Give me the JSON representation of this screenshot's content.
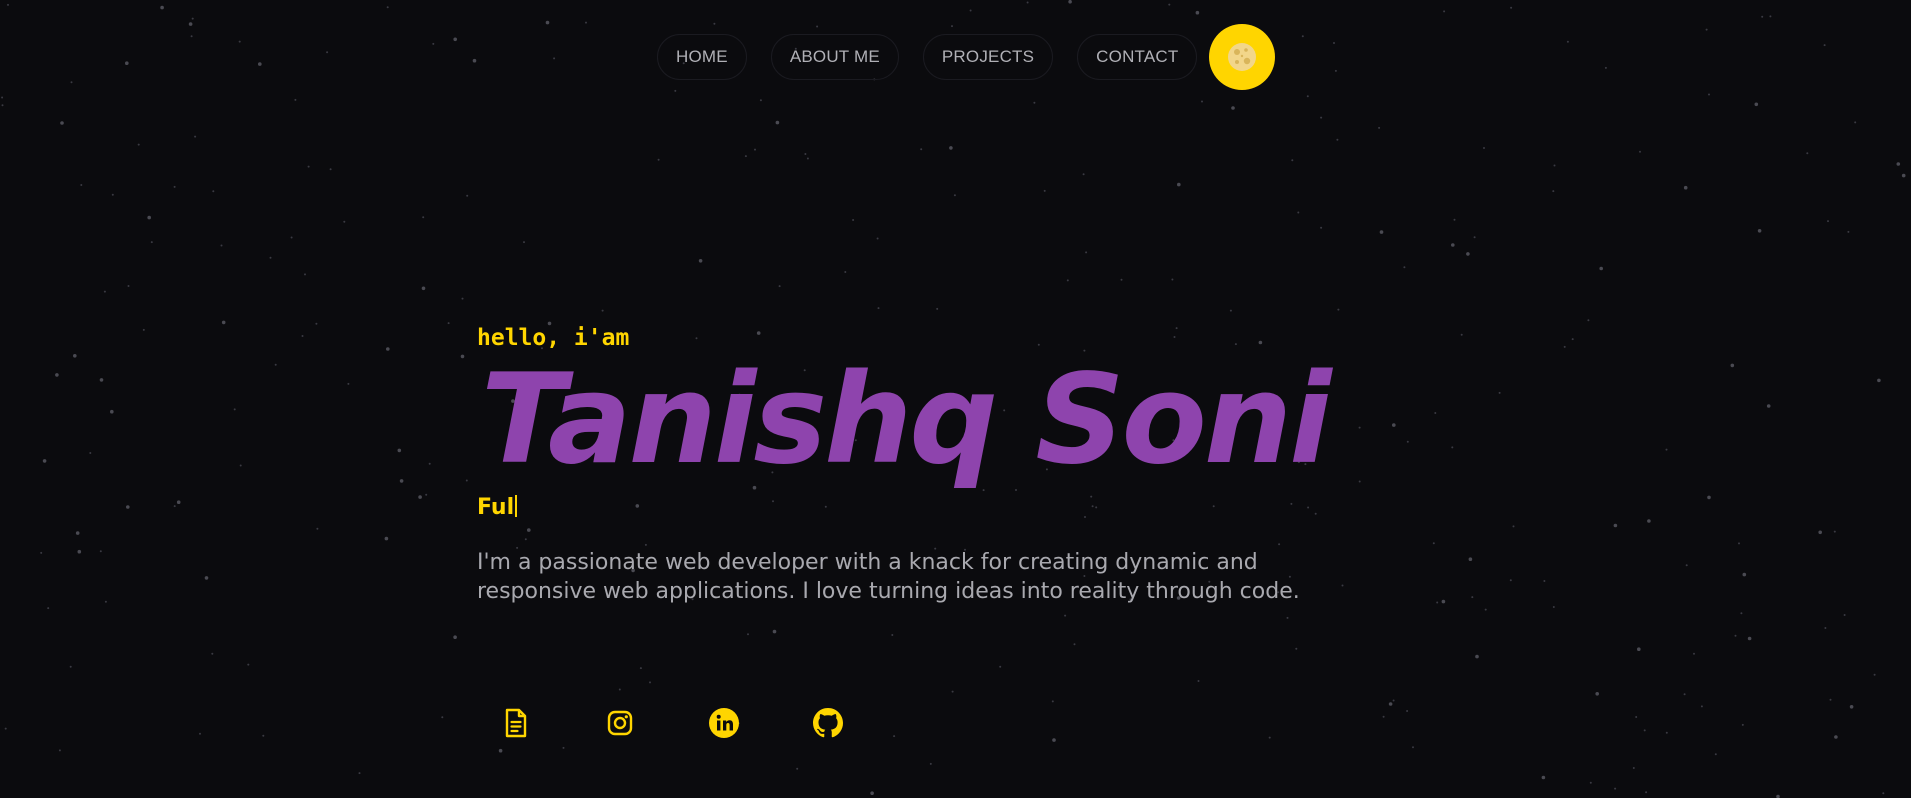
{
  "nav": {
    "items": [
      {
        "label": "HOME"
      },
      {
        "label": "ABOUT ME"
      },
      {
        "label": "PROJECTS"
      },
      {
        "label": "CONTACT"
      }
    ],
    "theme_toggle_icon": "moon-icon"
  },
  "hero": {
    "greeting": "hello, i'am",
    "name": "Tanishq Soni",
    "typed_text": "Ful",
    "bio": "I'm a passionate web developer with a knack for creating dynamic and responsive web applications. I love turning ideas into reality through code."
  },
  "socials": [
    {
      "icon": "resume-icon"
    },
    {
      "icon": "instagram-icon"
    },
    {
      "icon": "linkedin-icon"
    },
    {
      "icon": "github-icon"
    }
  ],
  "colors": {
    "background": "#0b0b0e",
    "accent_yellow": "#ffd500",
    "name_purple": "#8e44ad",
    "nav_text": "#b0b0b6",
    "bio_text": "#a9a9af"
  }
}
